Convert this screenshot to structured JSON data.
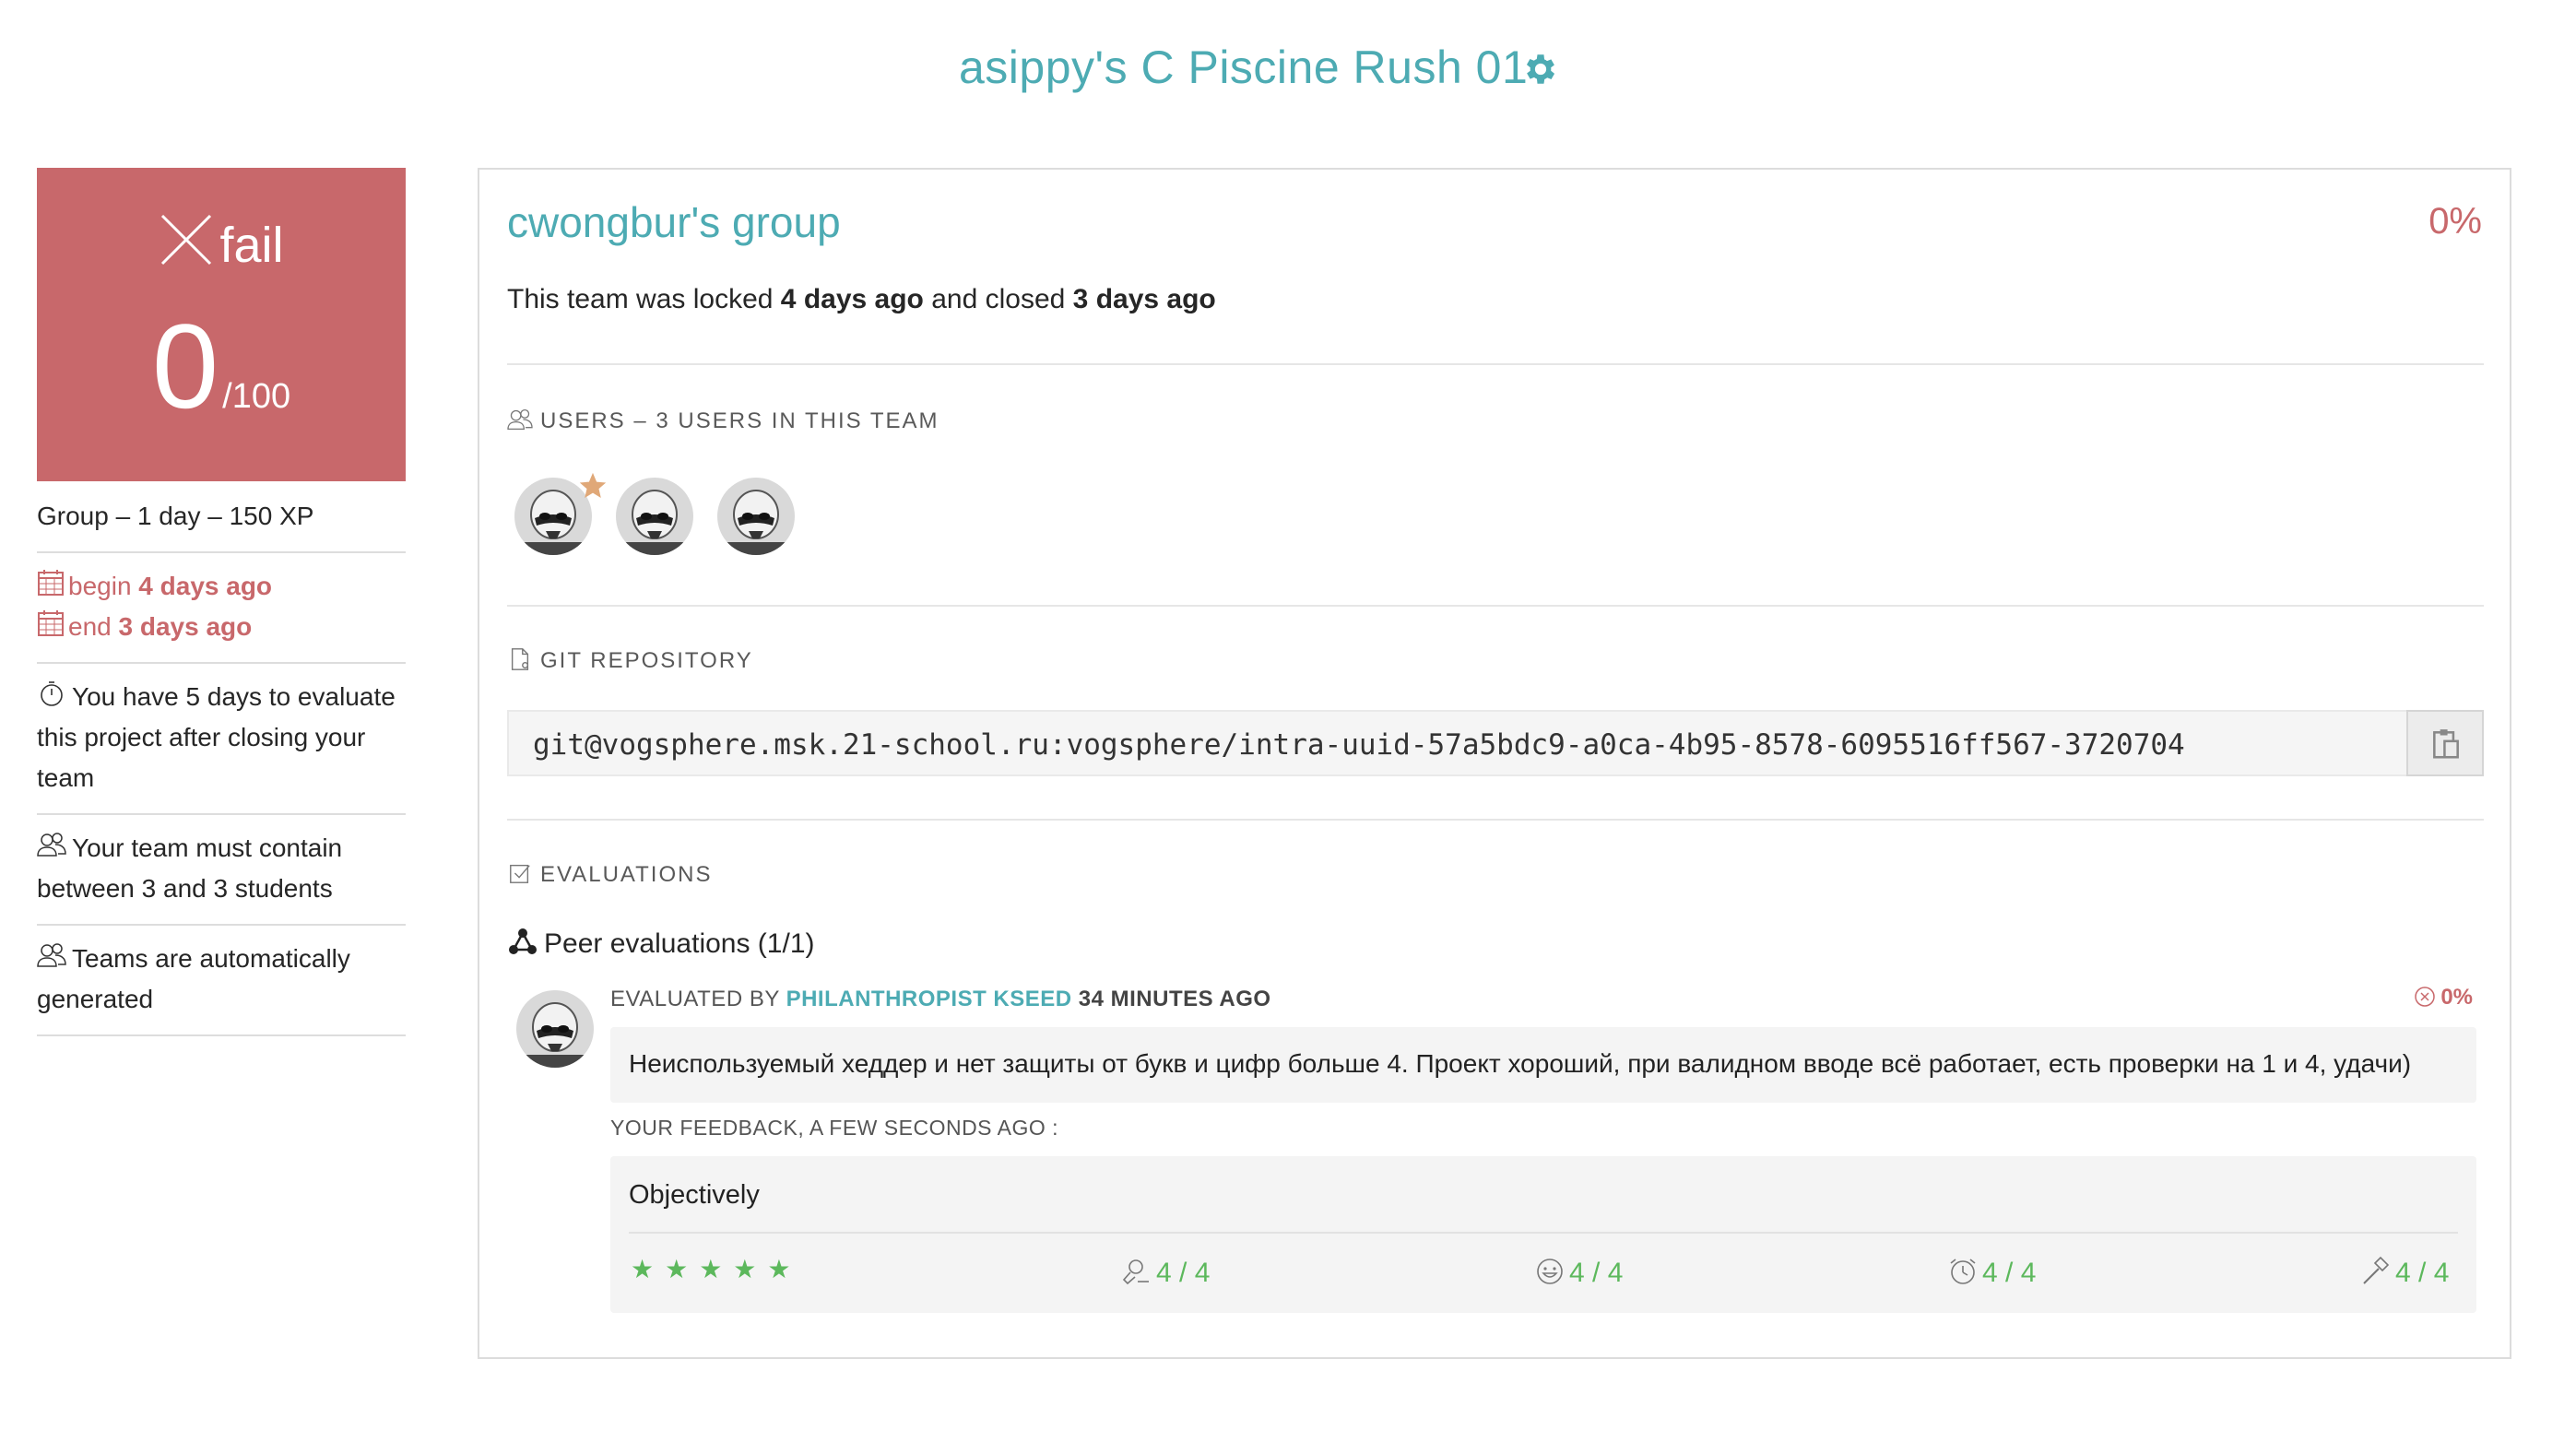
{
  "page": {
    "title": "asippy's C Piscine Rush 01"
  },
  "score": {
    "status": "fail",
    "value": "0",
    "denominator": "/100"
  },
  "sidebar": {
    "meta": "Group – 1 day – 150 XP",
    "begin_label": "begin",
    "begin_value": "4 days ago",
    "end_label": "end",
    "end_value": "3 days ago",
    "evaluate_note": "You have 5 days to evaluate this project after closing your team",
    "team_size_note": "Your team must contain between 3 and 3 students",
    "auto_note": "Teams are automatically generated"
  },
  "group": {
    "name": "cwongbur's group",
    "percent": "0%",
    "locked_prefix": "This team was locked",
    "locked_value": "4 days ago",
    "closed_prefix": "and closed",
    "closed_value": "3 days ago"
  },
  "users": {
    "label": "USERS – 3 USERS IN THIS TEAM",
    "count": 3
  },
  "git": {
    "label": "GIT REPOSITORY",
    "url": "git@vogsphere.msk.21-school.ru:vogsphere/intra-uuid-57a5bdc9-a0ca-4b95-8578-6095516ff567-3720704"
  },
  "evaluations": {
    "label": "EVALUATIONS",
    "peer_title": "Peer evaluations (1/1)",
    "item": {
      "evaluated_by_label": "EVALUATED BY",
      "evaluator": "PHILANTHROPIST KSEED",
      "time": "34 MINUTES AGO",
      "percent": "0%",
      "comment": "Неиспользуемый хеддер и нет защиты от букв и цифр больше 4. Проект хороший, при валидном вводе всё работает, есть проверки на 1 и 4, удачи)",
      "feedback_label": "YOUR FEEDBACK, A FEW SECONDS AGO :",
      "feedback": "Objectively",
      "stars": "★★★★★",
      "ratings": [
        {
          "icon": "interest-icon",
          "value": "4 / 4"
        },
        {
          "icon": "smile-icon",
          "value": "4 / 4"
        },
        {
          "icon": "alarm-clock-icon",
          "value": "4 / 4"
        },
        {
          "icon": "hammer-icon",
          "value": "4 / 4"
        }
      ]
    }
  },
  "colors": {
    "accent": "#4dabb3",
    "fail": "#c8686b",
    "success": "#5cb85c"
  }
}
